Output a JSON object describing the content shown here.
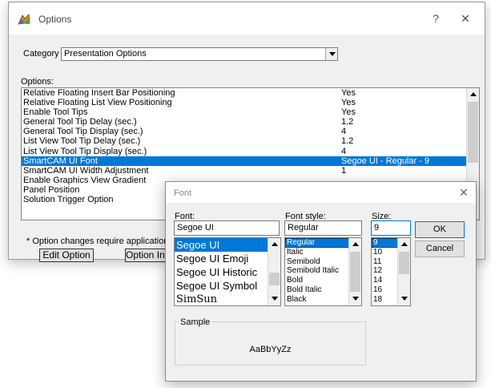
{
  "options_window": {
    "title": "Options",
    "help_glyph": "?",
    "close_glyph": "✕",
    "category_label": "Category",
    "category_value": "Presentation Options",
    "options_label": "Options:",
    "rows": [
      {
        "name": "Relative Floating Insert Bar Positioning",
        "value": "Yes"
      },
      {
        "name": "Relative Floating List View Positioning",
        "value": "Yes"
      },
      {
        "name": "Enable Tool Tips",
        "value": "Yes"
      },
      {
        "name": "General Tool Tip Delay (sec.)",
        "value": "1.2"
      },
      {
        "name": "General Tool Tip Display (sec.)",
        "value": "4"
      },
      {
        "name": "List View Tool Tip Delay (sec.)",
        "value": "1.2"
      },
      {
        "name": "List View Tool Tip Display (sec.)",
        "value": "4"
      },
      {
        "name": "SmartCAM UI Font",
        "value": "Segoe UI - Regular - 9"
      },
      {
        "name": "SmartCAM UI Width Adjustment",
        "value": "1"
      },
      {
        "name": "Enable Graphics View Gradient",
        "value": ""
      },
      {
        "name": "Panel Position",
        "value": ""
      },
      {
        "name": "Solution Trigger Option",
        "value": ""
      }
    ],
    "selected_row": 7,
    "footnote": "* Option changes require application",
    "edit_button": "Edit Option",
    "info_button": "Option Info"
  },
  "font_dialog": {
    "title": "Font",
    "close_glyph": "✕",
    "font_label": "Font:",
    "font_value": "Segoe UI",
    "fonts": [
      "Segoe UI",
      "Segoe UI Emoji",
      "Segoe UI Historic",
      "Segoe UI Symbol",
      "SimSun"
    ],
    "style_label": "Font style:",
    "style_value": "Regular",
    "styles": [
      "Regular",
      "Italic",
      "Semibold",
      "Semibold Italic",
      "Bold",
      "Bold Italic",
      "Black"
    ],
    "size_label": "Size:",
    "size_value": "9",
    "sizes": [
      "9",
      "10",
      "11",
      "12",
      "14",
      "16",
      "18"
    ],
    "ok_label": "OK",
    "cancel_label": "Cancel",
    "sample_label": "Sample",
    "sample_text": "AaBbYyZz"
  },
  "colors": {
    "selection": "#0078d7",
    "window_bg": "#f0f0f0"
  }
}
